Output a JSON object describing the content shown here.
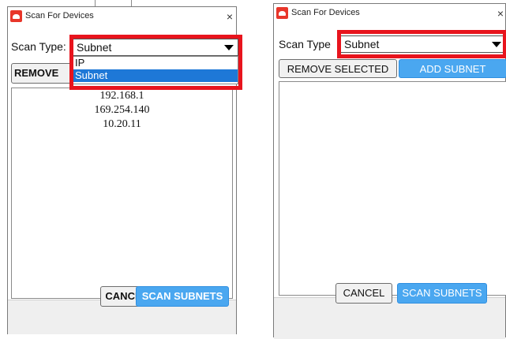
{
  "left": {
    "title": "Scan For Devices",
    "close": "×",
    "scan_type_label": "Scan Type:",
    "scan_type_value": "Subnet",
    "remove_label": "REMOVE",
    "dropdown_options": [
      "IP",
      "Subnet"
    ],
    "subnets": [
      "192.168.1",
      "169.254.140",
      "10.20.11"
    ],
    "cancel_label": "CANCEL",
    "scan_label": "SCAN SUBNETS"
  },
  "right": {
    "title": "Scan For Devices",
    "close": "×",
    "scan_type_label": "Scan Type",
    "scan_type_value": "Subnet",
    "remove_selected_label": "REMOVE SELECTED",
    "add_subnet_label": "ADD SUBNET",
    "cancel_label": "CANCEL",
    "scan_label": "SCAN SUBNETS"
  },
  "colors": {
    "highlight": "#e8141d",
    "accent": "#4aa7f0",
    "selected": "#1e78d7"
  },
  "icons": {
    "app": "app-logo-icon",
    "close": "close-icon",
    "dropdown": "chevron-down-icon"
  }
}
